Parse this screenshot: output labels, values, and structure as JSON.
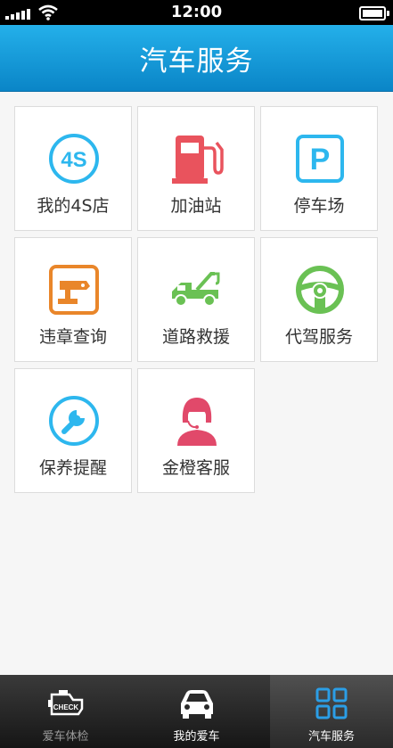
{
  "status": {
    "time": "12:00"
  },
  "header": {
    "title": "汽车服务"
  },
  "services": [
    {
      "label": "我的4S店",
      "icon": "4s-store-icon"
    },
    {
      "label": "加油站",
      "icon": "gas-pump-icon"
    },
    {
      "label": "停车场",
      "icon": "parking-icon"
    },
    {
      "label": "违章查询",
      "icon": "traffic-camera-icon"
    },
    {
      "label": "道路救援",
      "icon": "tow-truck-icon"
    },
    {
      "label": "代驾服务",
      "icon": "steering-wheel-icon"
    },
    {
      "label": "保养提醒",
      "icon": "wrench-icon"
    },
    {
      "label": "金橙客服",
      "icon": "customer-service-icon"
    }
  ],
  "icon_text": {
    "four_s": "4S",
    "parking": "P",
    "check": "CHECK"
  },
  "tabs": [
    {
      "label": "爱车体检",
      "icon": "engine-check-icon",
      "active": false
    },
    {
      "label": "我的爱车",
      "icon": "car-icon",
      "active": false
    },
    {
      "label": "汽车服务",
      "icon": "grid-icon",
      "active": true
    }
  ],
  "colors": {
    "header": "#1ba0dc",
    "icon_blue": "#2db7ee",
    "icon_red": "#e9535d",
    "icon_orange": "#e9862a",
    "icon_green": "#6ac154",
    "icon_pink": "#e1496a"
  }
}
